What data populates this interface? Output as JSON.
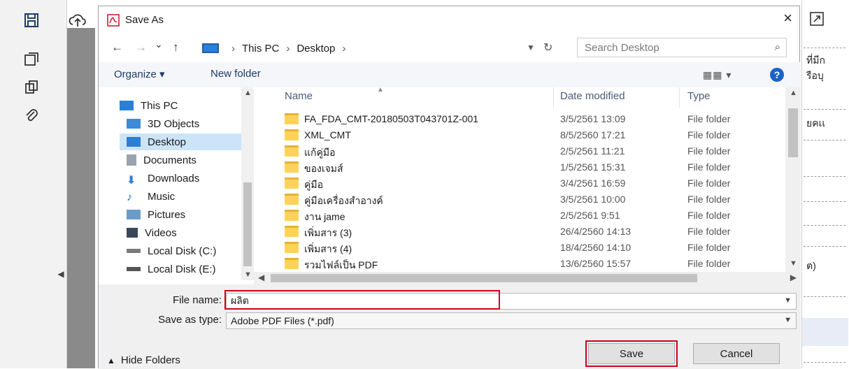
{
  "dialog": {
    "title": "Save As",
    "close_glyph": "×"
  },
  "nav": {
    "back_glyph": "←",
    "forward_glyph": "→",
    "recent_glyph": "⌄",
    "up_glyph": "↑",
    "path": [
      "This PC",
      "Desktop"
    ],
    "path_sep": "›",
    "search_placeholder": "Search Desktop"
  },
  "toolbar": {
    "organize_label": "Organize ▾",
    "new_folder_label": "New folder",
    "view_glyph": "▦▦ ▾",
    "help_glyph": "?"
  },
  "sidebar": {
    "items": [
      {
        "label": "This PC",
        "icon": "pc-icon",
        "color": "#2b7fd6",
        "selected": false
      },
      {
        "label": "3D Objects",
        "icon": "3d-objects-icon",
        "color": "#3c8ad8",
        "selected": false
      },
      {
        "label": "Desktop",
        "icon": "desktop-icon",
        "color": "#2b7fd6",
        "selected": true
      },
      {
        "label": "Documents",
        "icon": "documents-icon",
        "color": "#9aa3ad",
        "selected": false
      },
      {
        "label": "Downloads",
        "icon": "downloads-icon",
        "color": "#2b7fd6",
        "selected": false
      },
      {
        "label": "Music",
        "icon": "music-icon",
        "color": "#1f6fc8",
        "selected": false
      },
      {
        "label": "Pictures",
        "icon": "pictures-icon",
        "color": "#6b9bc9",
        "selected": false
      },
      {
        "label": "Videos",
        "icon": "videos-icon",
        "color": "#39475a",
        "selected": false
      },
      {
        "label": "Local Disk (C:)",
        "icon": "disk-c-icon",
        "color": "#7a7a7a",
        "selected": false
      },
      {
        "label": "Local Disk (E:)",
        "icon": "disk-e-icon",
        "color": "#555555",
        "selected": false
      }
    ]
  },
  "filelist": {
    "columns": {
      "name": "Name",
      "date": "Date modified",
      "type": "Type"
    },
    "rows": [
      {
        "name": "FA_FDA_CMT-20180503T043701Z-001",
        "date": "3/5/2561 13:09",
        "type": "File folder"
      },
      {
        "name": "XML_CMT",
        "date": "8/5/2560 17:21",
        "type": "File folder"
      },
      {
        "name": "แก้คู่มือ",
        "date": "2/5/2561 11:21",
        "type": "File folder"
      },
      {
        "name": "ของเจมส์",
        "date": "1/5/2561 15:31",
        "type": "File folder"
      },
      {
        "name": "คู่มือ",
        "date": "3/4/2561 16:59",
        "type": "File folder"
      },
      {
        "name": "คู่มือเครื่องสำอางค์",
        "date": "3/5/2561 10:00",
        "type": "File folder"
      },
      {
        "name": "งาน jame",
        "date": "2/5/2561 9:51",
        "type": "File folder"
      },
      {
        "name": "เพิ่มสาร (3)",
        "date": "26/4/2560 14:13",
        "type": "File folder"
      },
      {
        "name": "เพิ่มสาร (4)",
        "date": "18/4/2560 14:10",
        "type": "File folder"
      },
      {
        "name": "รวมไฟล์เป็น PDF",
        "date": "13/6/2560 15:57",
        "type": "File folder"
      }
    ]
  },
  "bottom": {
    "file_name_label": "File name:",
    "file_name_value": "ผลิต",
    "save_type_label": "Save as type:",
    "save_type_value": "Adobe PDF Files (*.pdf)",
    "hide_folders_label": "Hide Folders",
    "save_label": "Save",
    "cancel_label": "Cancel",
    "highlight_color": "#d0021b"
  },
  "background_doc": {
    "snippets": [
      "ที่มีก",
      "รือบุ",
      "ยคเเ",
      "ต)"
    ]
  }
}
